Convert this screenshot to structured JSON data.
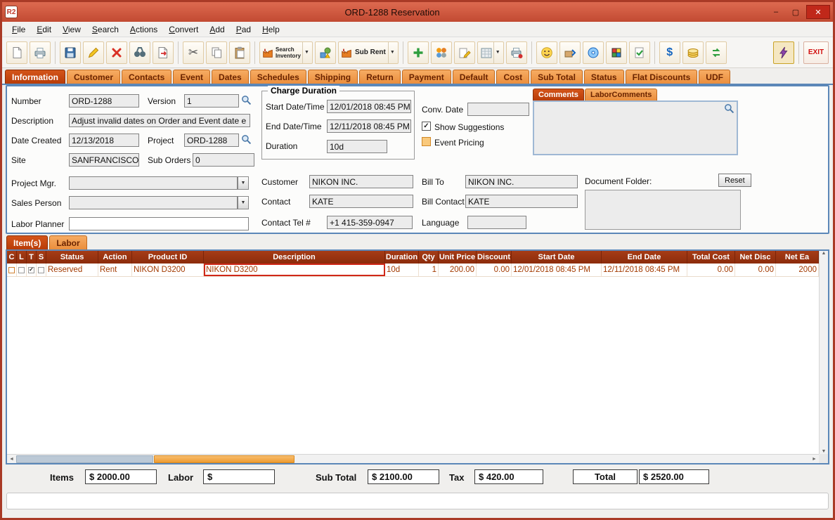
{
  "window": {
    "title": "ORD-1288 Reservation",
    "app_icon": "R2"
  },
  "icons": {
    "minimize": "–",
    "maximize": "▢",
    "close": "✕",
    "dropdown": "▼",
    "check": "✓",
    "cut": "✂",
    "dollar": "$",
    "scroll_left": "◄",
    "scroll_right": "►",
    "scroll_up": "▲",
    "scroll_down": "▼"
  },
  "colors": {
    "title_red": "#cd5240",
    "tab_orange": "#ee9447",
    "tab_active": "#c1440e",
    "table_header_red": "#9a3412",
    "row_text": "#a33a00",
    "scroll_thumb_orange": "#f0a030"
  },
  "menu": {
    "items": [
      "File",
      "Edit",
      "View",
      "Search",
      "Actions",
      "Convert",
      "Add",
      "Pad",
      "Help"
    ]
  },
  "toolbar": {
    "search_inventory_line1": "Search",
    "search_inventory_line2": "Inventory",
    "sub_rent": "Sub Rent",
    "exit": "EXIT"
  },
  "tabs": [
    "Information",
    "Customer",
    "Contacts",
    "Event",
    "Dates",
    "Schedules",
    "Shipping",
    "Return",
    "Payment",
    "Default",
    "Cost",
    "Sub Total",
    "Status",
    "Flat Discounts",
    "UDF"
  ],
  "form": {
    "number_label": "Number",
    "number": "ORD-1288",
    "version_label": "Version",
    "version": "1",
    "description_label": "Description",
    "description": "Adjust invalid dates on Order and Event date e",
    "date_created_label": "Date Created",
    "date_created": "12/13/2018",
    "project_label": "Project",
    "project": "ORD-1288",
    "site_label": "Site",
    "site": "SANFRANCISCO",
    "sub_orders_label": "Sub Orders",
    "sub_orders": "0",
    "project_mgr_label": "Project Mgr.",
    "project_mgr": "",
    "sales_person_label": "Sales Person",
    "sales_person": "",
    "labor_planner_label": "Labor Planner",
    "labor_planner": "",
    "charge_duration_legend": "Charge Duration",
    "start_label": "Start Date/Time",
    "start": "12/01/2018 08:45 PM",
    "end_label": "End Date/Time",
    "end": "12/11/2018 08:45 PM",
    "duration_label": "Duration",
    "duration": "10d",
    "conv_date_label": "Conv. Date",
    "conv_date": "",
    "show_suggestions_label": "Show Suggestions",
    "event_pricing_label": "Event Pricing",
    "customer_label": "Customer",
    "customer": "NIKON INC.",
    "bill_to_label": "Bill To",
    "bill_to": "NIKON INC.",
    "contact_label": "Contact",
    "contact": "KATE",
    "bill_contact_label": "Bill Contact",
    "bill_contact": "KATE",
    "contact_tel_label": "Contact Tel #",
    "contact_tel": "+1 415-359-0947",
    "language_label": "Language",
    "language": "",
    "comments_tab": "Comments",
    "labor_comments_tab": "LaborComments",
    "document_folder_label": "Document Folder:",
    "reset_button": "Reset"
  },
  "items_section": {
    "items_tab": "Item(s)",
    "labor_tab": "Labor"
  },
  "items_table": {
    "columns": [
      "C",
      "L",
      "T",
      "S",
      "Status",
      "Action",
      "Product ID",
      "Description",
      "Duration",
      "Qty",
      "Unit Price",
      "Discount",
      "Start Date",
      "End Date",
      "Total Cost",
      "Net Disc",
      "Net Ea"
    ],
    "row": {
      "status": "Reserved",
      "action": "Rent",
      "product_id": "NIKON D3200",
      "description": "NIKON D3200",
      "duration": "10d",
      "qty": "1",
      "unit_price": "200.00",
      "discount": "0.00",
      "start_date": "12/01/2018 08:45 PM",
      "end_date": "12/11/2018 08:45 PM",
      "total_cost": "0.00",
      "net_disc": "0.00",
      "net_ea": "2000"
    }
  },
  "totals": {
    "items_label": "Items",
    "items_value": "$ 2000.00",
    "labor_label": "Labor",
    "labor_value": "$",
    "sub_total_label": "Sub Total",
    "sub_total_value": "$ 2100.00",
    "tax_label": "Tax",
    "tax_value": "$ 420.00",
    "total_label": "Total",
    "total_value": "$ 2520.00"
  }
}
